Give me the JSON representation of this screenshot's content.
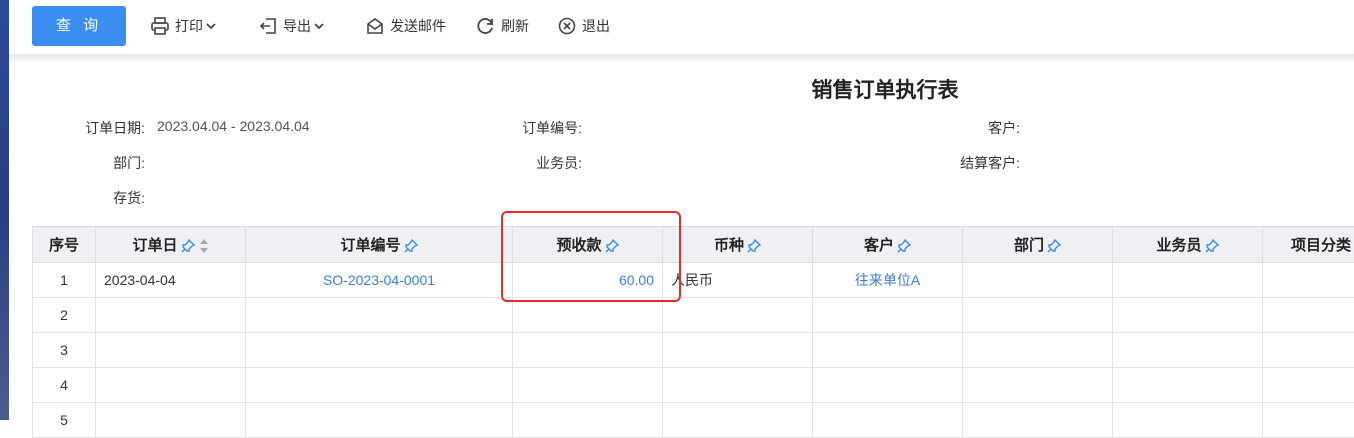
{
  "toolbar": {
    "query_label": "查 询",
    "print_label": "打印",
    "export_label": "导出",
    "email_label": "发送邮件",
    "refresh_label": "刷新",
    "exit_label": "退出"
  },
  "report": {
    "title": "销售订单执行表"
  },
  "filters": {
    "order_date_label": "订单日期:",
    "order_date_value": "2023.04.04 - 2023.04.04",
    "order_no_label": "订单编号:",
    "customer_label": "客户:",
    "department_label": "部门:",
    "salesperson_label": "业务员:",
    "settle_customer_label": "结算客户:",
    "inventory_label": "存货:"
  },
  "table": {
    "headers": [
      "序号",
      "订单日",
      "订单编号",
      "预收款",
      "币种",
      "客户",
      "部门",
      "业务员",
      "项目分类"
    ],
    "rows": [
      {
        "idx": "1",
        "date": "2023-04-04",
        "order_no": "SO-2023-04-0001",
        "prepay": "60.00",
        "currency": "人民币",
        "customer": "往来单位A",
        "dept": "",
        "sales": "",
        "proj": ""
      },
      {
        "idx": "2",
        "date": "",
        "order_no": "",
        "prepay": "",
        "currency": "",
        "customer": "",
        "dept": "",
        "sales": "",
        "proj": ""
      },
      {
        "idx": "3",
        "date": "",
        "order_no": "",
        "prepay": "",
        "currency": "",
        "customer": "",
        "dept": "",
        "sales": "",
        "proj": ""
      },
      {
        "idx": "4",
        "date": "",
        "order_no": "",
        "prepay": "",
        "currency": "",
        "customer": "",
        "dept": "",
        "sales": "",
        "proj": ""
      },
      {
        "idx": "5",
        "date": "",
        "order_no": "",
        "prepay": "",
        "currency": "",
        "customer": "",
        "dept": "",
        "sales": "",
        "proj": ""
      }
    ]
  },
  "colors": {
    "accent": "#3b8ef0",
    "link": "#3b7dd8",
    "highlight": "#e82b2b"
  }
}
